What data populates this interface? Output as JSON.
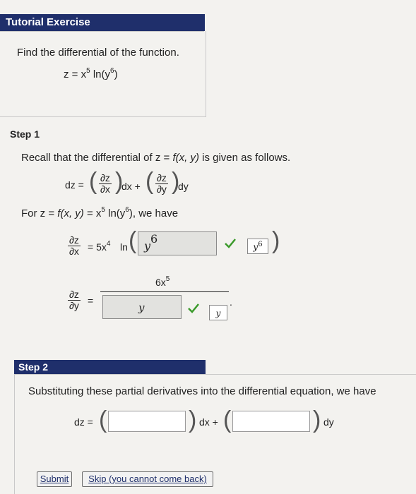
{
  "header": {
    "title": "Tutorial Exercise"
  },
  "problem": {
    "instruction": "Find the differential of the function.",
    "function_lhs": "z = x",
    "function_exp": "5",
    "function_mid": " ln(y",
    "function_exp2": "6",
    "function_end": ")"
  },
  "step1": {
    "title": "Step 1",
    "recall": "Recall that the differential of",
    "recall_z": "z = ",
    "recall_f": "f(x, y)",
    "recall_end": "is given as follows.",
    "dz_eq": "dz =",
    "dz_num": "∂z",
    "dx_den": "∂x",
    "dy_den": "∂y",
    "dx_label": "dx +",
    "dy_label": "dy",
    "for_prefix": "For",
    "for_z": "z = ",
    "for_f": "f(x, y)",
    "for_rest": " = x",
    "for_exp": "5",
    "for_ln": " ln(y",
    "for_exp2": "6",
    "for_end": "),  we have",
    "pdx_eq": "= 5x",
    "pdx_exp": "4",
    "pdx_ln": "ln",
    "pdx_input_value": "y",
    "pdx_input_exp": "6",
    "pdx_answer": "y",
    "pdx_answer_exp": "6",
    "pdy_eq": "=",
    "pdy_numerator": "6x",
    "pdy_numerator_exp": "5",
    "pdy_input_value": "y",
    "pdy_answer": "y",
    "pdy_period": "."
  },
  "step2": {
    "title": "Step 2",
    "text": "Substituting these partial derivatives into the differential equation, we have",
    "dz_eq": "dz =",
    "dx_label": "dx +",
    "dy_label": "dy",
    "input1_value": "",
    "input2_value": ""
  },
  "buttons": {
    "submit": "Submit",
    "skip": "Skip (you cannot come back)"
  },
  "colors": {
    "accent": "#1f2f6b",
    "check": "#3a9a2a"
  }
}
